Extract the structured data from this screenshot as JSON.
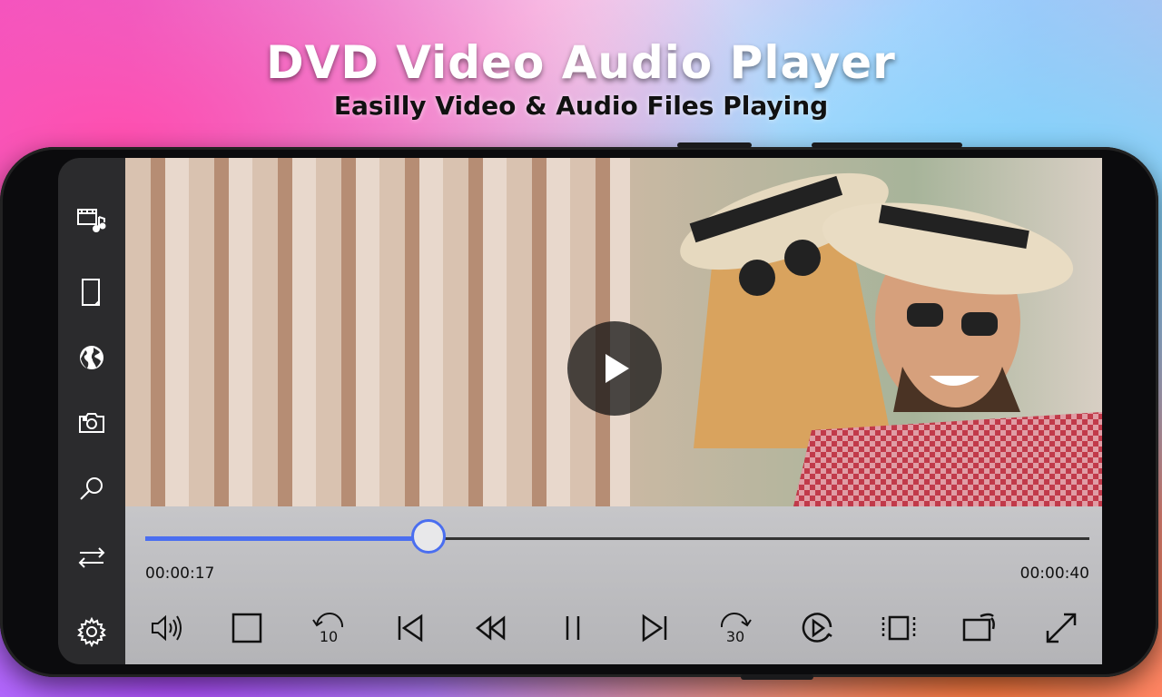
{
  "banner": {
    "title": "DVD Video Audio Player",
    "subtitle": "Easilly Video & Audio Files Playing"
  },
  "sidebar": {
    "items": [
      {
        "icon": "media-library-icon"
      },
      {
        "icon": "file-icon"
      },
      {
        "icon": "globe-icon"
      },
      {
        "icon": "camera-icon"
      },
      {
        "icon": "search-icon"
      },
      {
        "icon": "swap-icon"
      },
      {
        "icon": "settings-icon"
      }
    ]
  },
  "player": {
    "current_time": "00:00:17",
    "total_time": "00:00:40",
    "progress": 0.3,
    "rewind_seconds": "10",
    "forward_seconds": "30",
    "accent_color": "#4a6ef0"
  }
}
